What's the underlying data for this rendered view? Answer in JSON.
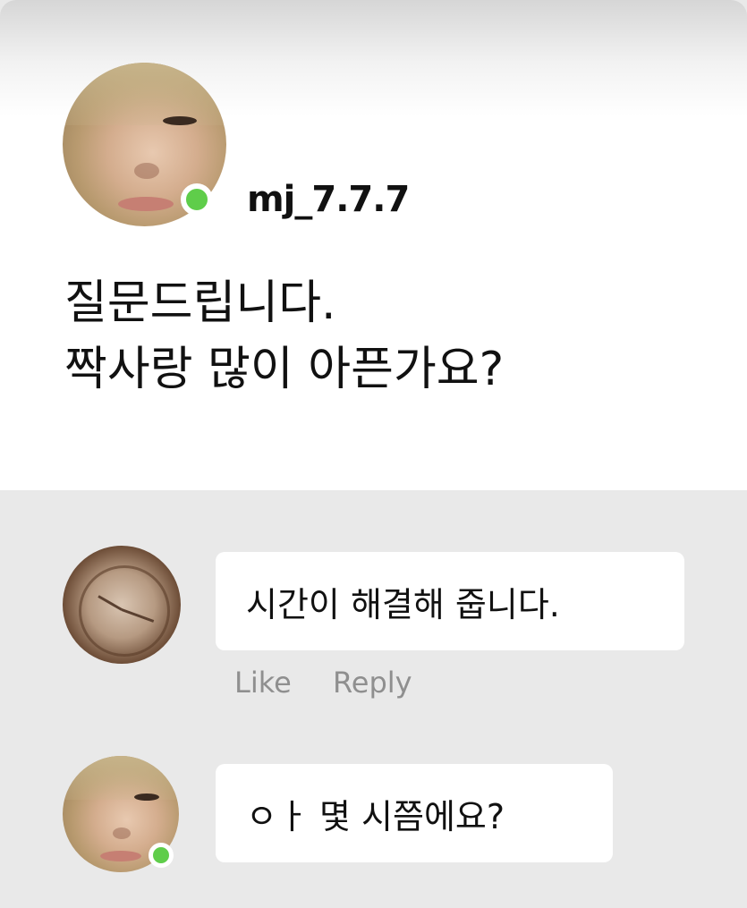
{
  "post": {
    "username": "mj_7.7.7",
    "text_line1": "질문드립니다.",
    "text_line2": "짝사랑 많이 아픈가요?",
    "status": "online"
  },
  "comments": [
    {
      "text": "시간이 해결해 줍니다.",
      "actions": {
        "like": "Like",
        "reply": "Reply"
      },
      "avatar": "clock-photo"
    },
    {
      "text": "ㅇㅏ 몇 시쯤에요?",
      "avatar": "user-photo",
      "status": "online"
    }
  ],
  "colors": {
    "online": "#5fcd4a",
    "background": "#e9e9e9",
    "action_text": "#8f8f8f"
  }
}
